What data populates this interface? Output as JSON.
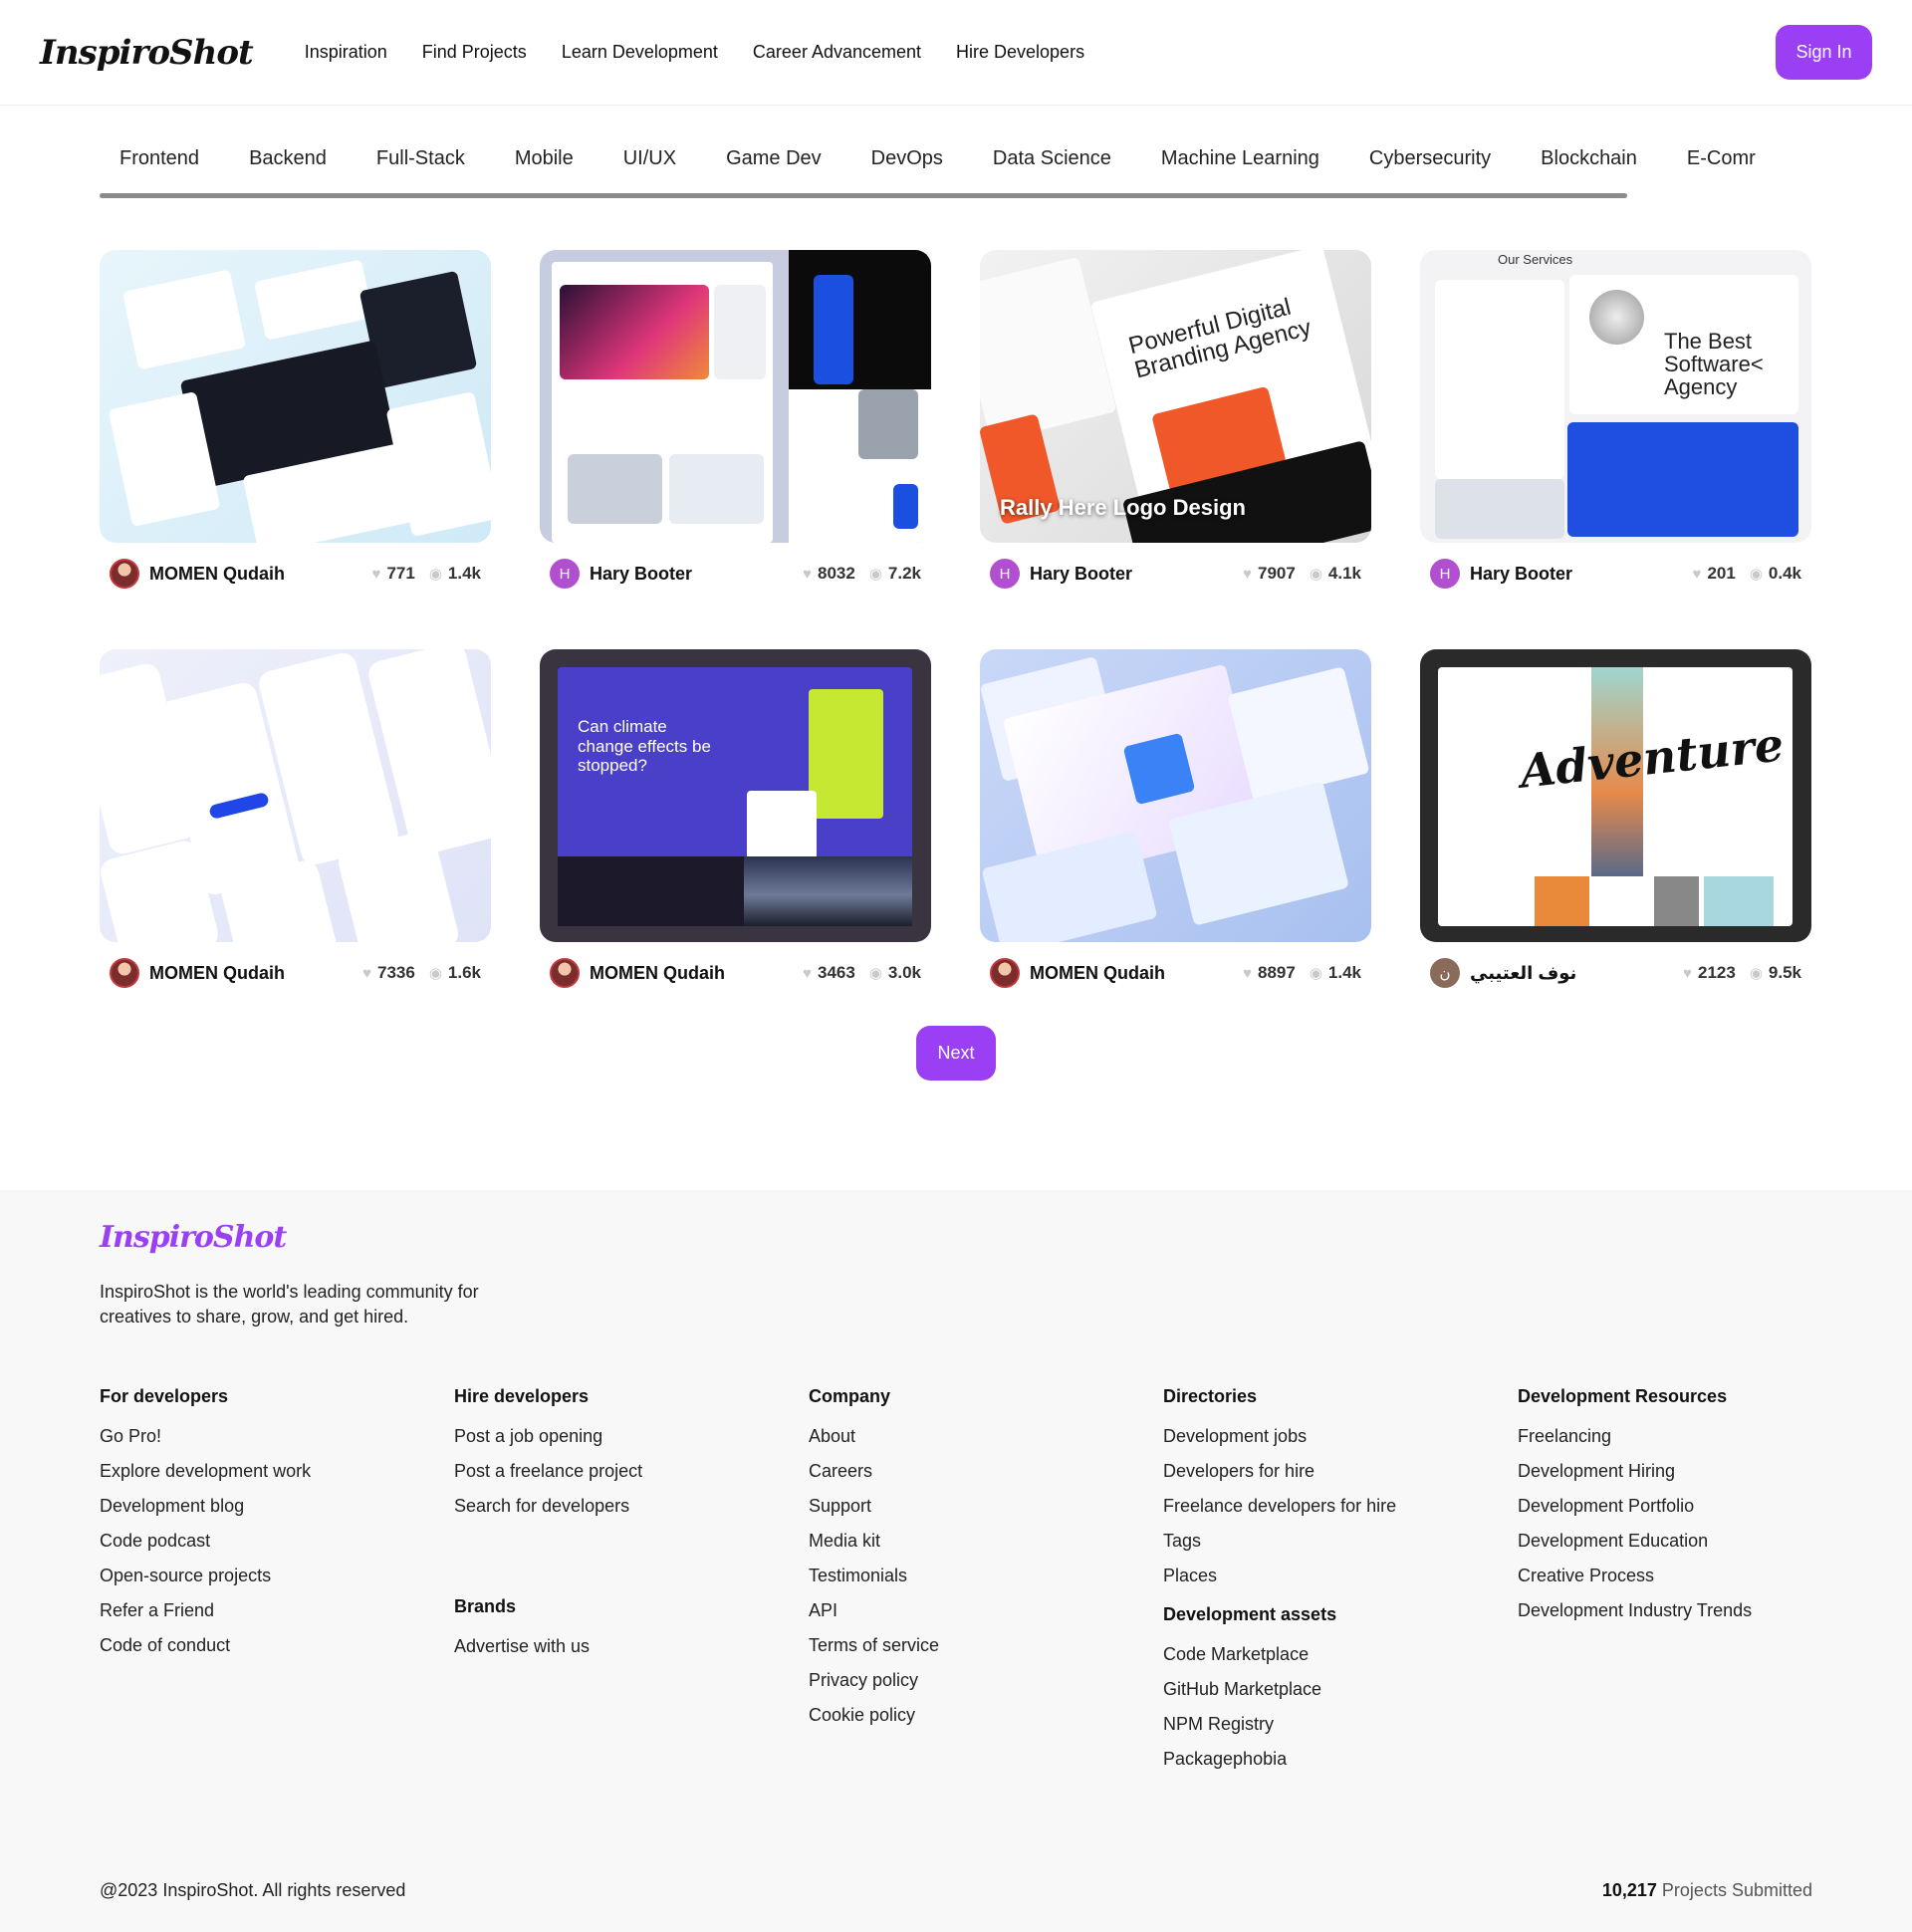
{
  "header": {
    "logo": "InspiroShot",
    "nav": [
      "Inspiration",
      "Find Projects",
      "Learn Development",
      "Career Advancement",
      "Hire Developers"
    ],
    "signin": "Sign In"
  },
  "categories": [
    "Frontend",
    "Backend",
    "Full-Stack",
    "Mobile",
    "UI/UX",
    "Game Dev",
    "DevOps",
    "Data Science",
    "Machine Learning",
    "Cybersecurity",
    "Blockchain",
    "E-Comr"
  ],
  "cards": [
    {
      "author": "MOMEN Qudaih",
      "likes": "771",
      "views": "1.4k",
      "avatar": "photo",
      "initial": ""
    },
    {
      "author": "Hary Booter",
      "likes": "8032",
      "views": "7.2k",
      "avatar": "letter",
      "initial": "H"
    },
    {
      "author": "Hary Booter",
      "likes": "7907",
      "views": "4.1k",
      "avatar": "letter",
      "initial": "H",
      "title": "Rally Here Logo Design"
    },
    {
      "author": "Hary Booter",
      "likes": "201",
      "views": "0.4k",
      "avatar": "letter",
      "initial": "H"
    },
    {
      "author": "MOMEN Qudaih",
      "likes": "7336",
      "views": "1.6k",
      "avatar": "photo",
      "initial": ""
    },
    {
      "author": "MOMEN Qudaih",
      "likes": "3463",
      "views": "3.0k",
      "avatar": "photo",
      "initial": ""
    },
    {
      "author": "MOMEN Qudaih",
      "likes": "8897",
      "views": "1.4k",
      "avatar": "photo",
      "initial": ""
    },
    {
      "author": "نوف العتيبي",
      "likes": "2123",
      "views": "9.5k",
      "avatar": "letter",
      "initial": "ن"
    }
  ],
  "thumb_text": {
    "t3_heading": "Powerful Digital Branding Agency",
    "t4_heading": "The Best Software< Agency",
    "t4_services": "Our Services",
    "t6_heading": "Can climate change effects be stopped?",
    "t8_heading": "Adventure"
  },
  "next": "Next",
  "footer": {
    "logo": "InspiroShot",
    "tagline": "InspiroShot is the world's leading community for creatives to share, grow, and get hired.",
    "columns": [
      {
        "title": "For developers",
        "links": [
          "Go Pro!",
          "Explore development work",
          "Development blog",
          "Code podcast",
          "Open-source projects",
          "Refer a Friend",
          "Code of conduct"
        ]
      },
      {
        "title": "Hire developers",
        "links": [
          "Post a job opening",
          "Post a freelance project",
          "Search for developers"
        ],
        "subtitle": "Brands",
        "sublinks": [
          "Advertise with us"
        ]
      },
      {
        "title": "Company",
        "links": [
          "About",
          "Careers",
          "Support",
          "Media kit",
          "Testimonials",
          "API",
          "Terms of service",
          "Privacy policy",
          "Cookie policy"
        ]
      },
      {
        "title": "Directories",
        "links": [
          "Development jobs",
          "Developers for hire",
          "Freelance developers for hire",
          "Tags",
          "Places"
        ],
        "subtitle": "Development assets",
        "sublinks": [
          "Code Marketplace",
          "GitHub Marketplace",
          "NPM Registry",
          "Packagephobia"
        ]
      },
      {
        "title": "Development Resources",
        "links": [
          "Freelancing",
          "Development Hiring",
          "Development Portfolio",
          "Development Education",
          "Creative Process",
          "Development Industry Trends"
        ]
      }
    ],
    "copyright": "@2023 InspiroShot. All rights reserved",
    "projects_count": "10,217",
    "projects_label": "Projects Submitted"
  },
  "colors": {
    "accent": "#9b3ff5",
    "avatar_h": "#b04fcf"
  }
}
